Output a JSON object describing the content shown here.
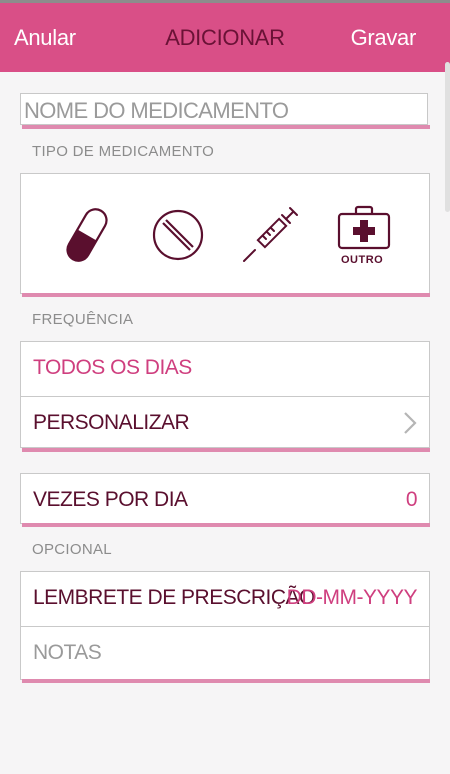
{
  "header": {
    "cancel_label": "Anular",
    "title": "ADICIONAR",
    "save_label": "Gravar"
  },
  "name_field": {
    "placeholder": "NOME DO MEDICAMENTO"
  },
  "type_section": {
    "label": "TIPO DE MEDICAMENTO",
    "icons": [
      "capsule-icon",
      "pill-tablet-icon",
      "syringe-icon",
      "medical-kit-icon"
    ],
    "other_label": "OUTRO"
  },
  "frequency_section": {
    "label": "FREQUÊNCIA",
    "every_day_label": "TODOS OS DIAS",
    "customize_label": "PERSONALIZAR"
  },
  "times_per_day": {
    "label": "VEZES POR DIA",
    "value": "0"
  },
  "optional_section": {
    "label": "OPCIONAL",
    "prescription_reminder_label": "LEMBRETE DE PRESCRIÇÃO",
    "prescription_date_placeholder": "DD-MM-YYYY",
    "notes_placeholder": "NOTAS"
  },
  "colors": {
    "header": "#d94f87",
    "accent": "#cf3f7f",
    "dark": "#5a0f2e",
    "underline": "#df8aaf"
  }
}
